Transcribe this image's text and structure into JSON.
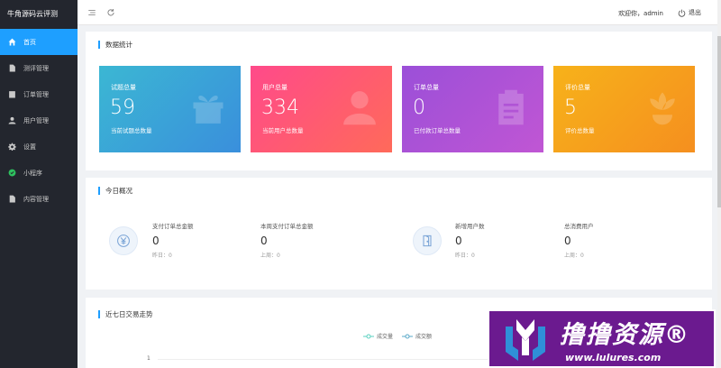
{
  "app": {
    "brand": "牛角源码云评测"
  },
  "sidebar": {
    "items": [
      {
        "label": "首页",
        "icon": "home-icon",
        "active": true
      },
      {
        "label": "测评管理",
        "icon": "file-icon"
      },
      {
        "label": "订单管理",
        "icon": "order-icon"
      },
      {
        "label": "用户管理",
        "icon": "user-icon"
      },
      {
        "label": "设置",
        "icon": "gear-icon"
      },
      {
        "label": "小程序",
        "icon": "miniprogram-icon"
      },
      {
        "label": "内容管理",
        "icon": "document-icon"
      }
    ]
  },
  "topbar": {
    "welcome": "欢迎你，admin",
    "logout": "退出"
  },
  "stats_panel": {
    "title": "数据统计",
    "cards": [
      {
        "title": "试题总量",
        "value": "59",
        "sub": "当前试题总数量",
        "icon": "gift-icon",
        "color": "#3aa7d8"
      },
      {
        "title": "用户总量",
        "value": "334",
        "sub": "当前用户总数量",
        "icon": "user-icon",
        "color": "#ff4f7b"
      },
      {
        "title": "订单总量",
        "value": "0",
        "sub": "已付款订单总数量",
        "icon": "clipboard-icon",
        "color": "#a855d6"
      },
      {
        "title": "评价总量",
        "value": "5",
        "sub": "评价总数量",
        "icon": "flower-icon",
        "color": "#f7a21b"
      }
    ]
  },
  "today_panel": {
    "title": "今日概况",
    "stats": [
      {
        "label": "支付订单总金额",
        "value": "0",
        "prev": "昨日：0"
      },
      {
        "label": "本周支付订单总金额",
        "value": "0",
        "prev": "上周：0"
      },
      {
        "label": "新增用户数",
        "value": "0",
        "prev": "昨日：0"
      },
      {
        "label": "总消费用户",
        "value": "0",
        "prev": "上周：0"
      }
    ]
  },
  "trend_panel": {
    "title": "近七日交易走势",
    "legend": [
      "成交量",
      "成交额"
    ],
    "axis_tick": "1"
  },
  "watermark": {
    "text": "撸撸资源®",
    "url": "www.lulures.com"
  }
}
